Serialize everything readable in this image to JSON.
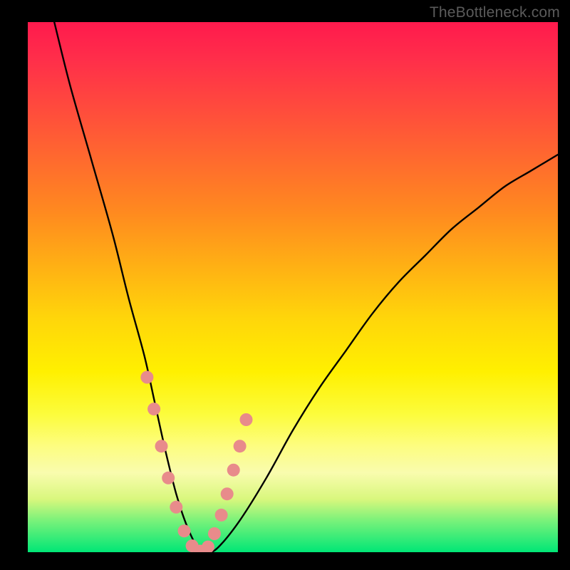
{
  "attribution": "TheBottleneck.com",
  "chart_data": {
    "type": "line",
    "title": "",
    "xlabel": "",
    "ylabel": "",
    "xlim": [
      0,
      100
    ],
    "ylim": [
      0,
      100
    ],
    "background_gradient": {
      "top": "#ff1a4d",
      "mid_upper": "#ffb014",
      "mid_lower": "#fff000",
      "bottom": "#00e676"
    },
    "series": [
      {
        "name": "bottleneck-curve",
        "stroke": "#000000",
        "x": [
          5,
          8,
          12,
          16,
          19,
          22,
          24,
          26,
          28,
          30,
          32,
          34,
          36,
          40,
          45,
          50,
          55,
          60,
          65,
          70,
          75,
          80,
          85,
          90,
          95,
          100
        ],
        "values": [
          100,
          88,
          74,
          60,
          48,
          37,
          28,
          19,
          11,
          5,
          1,
          0,
          1,
          6,
          14,
          23,
          31,
          38,
          45,
          51,
          56,
          61,
          65,
          69,
          72,
          75
        ]
      },
      {
        "name": "marker-dots",
        "stroke": "#e88b8b",
        "type_hint": "scatter",
        "x": [
          22.5,
          23.8,
          25.2,
          26.5,
          28.0,
          29.5,
          31.0,
          32.5,
          34.0,
          35.2,
          36.5,
          37.6,
          38.8,
          40.0,
          41.2
        ],
        "values": [
          33.0,
          27.0,
          20.0,
          14.0,
          8.5,
          4.0,
          1.2,
          0.2,
          1.0,
          3.5,
          7.0,
          11.0,
          15.5,
          20.0,
          25.0
        ]
      }
    ]
  }
}
